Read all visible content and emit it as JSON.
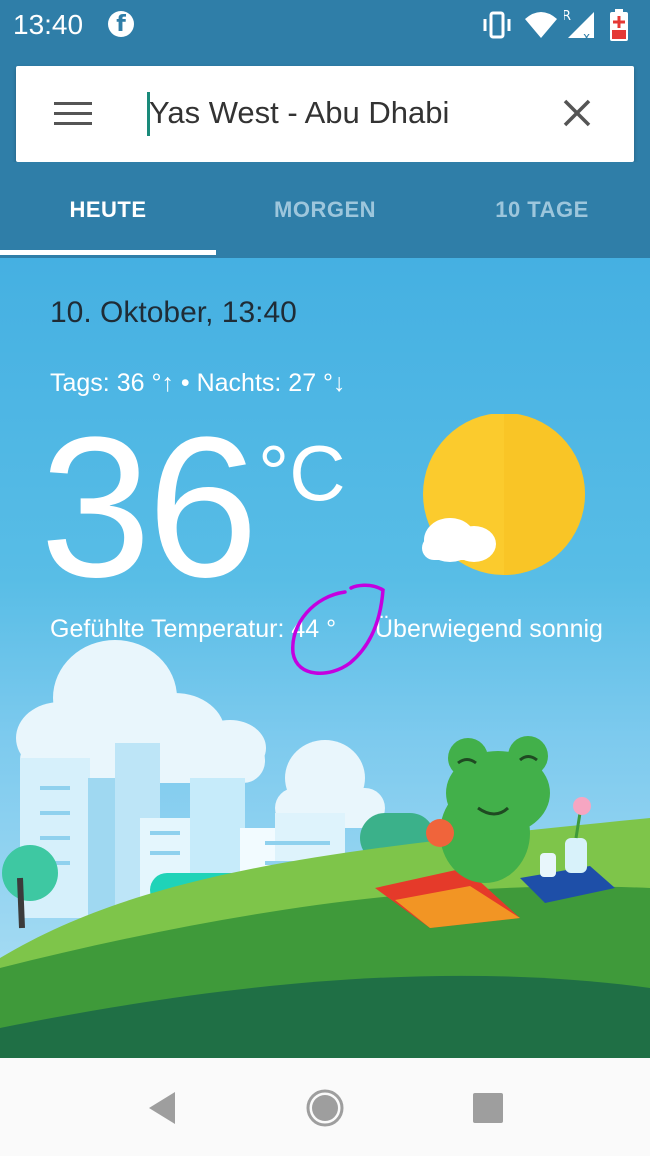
{
  "status_bar": {
    "time": "13:40",
    "icons": [
      "facebook-icon",
      "vibrate-icon",
      "wifi-icon",
      "signal-roaming-icon",
      "battery-low-icon"
    ],
    "roaming_label": "R"
  },
  "search": {
    "value": "Yas West - Abu Dhabi",
    "icons": [
      "menu-icon",
      "close-icon"
    ]
  },
  "tabs": [
    {
      "label": "HEUTE",
      "active": true
    },
    {
      "label": "MORGEN",
      "active": false
    },
    {
      "label": "10 TAGE",
      "active": false
    }
  ],
  "weather": {
    "datetime": "10. Oktober, 13:40",
    "hilo": "Tags: 36 °↑ • Nachts: 27 °↓",
    "temperature": "36",
    "unit": "°C",
    "feels_like": "Gefühlte Temperatur: 44 °",
    "condition": "Überwiegend sonnig",
    "icon": "sunny-with-cloud-icon"
  },
  "colors": {
    "header_blue": "#2f7ea8",
    "sky_blue": "#45b0e2",
    "sun_yellow": "#fbcb2d",
    "annotation_purple": "#c400e0"
  },
  "navbar": {
    "icons": [
      "back-icon",
      "home-icon",
      "recents-icon"
    ]
  }
}
